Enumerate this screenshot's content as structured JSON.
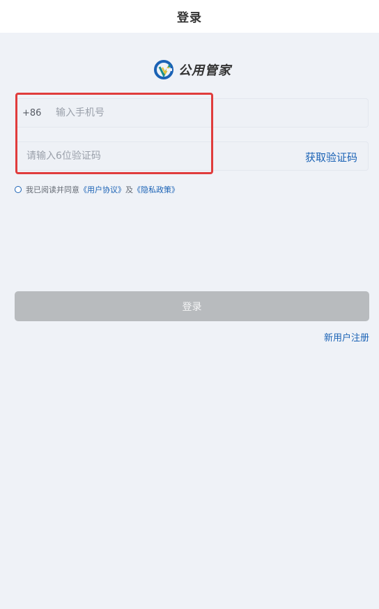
{
  "header": {
    "title": "登录"
  },
  "logo": {
    "text": "公用管家",
    "icon": "company-logo-icon"
  },
  "form": {
    "phone": {
      "prefix": "+86",
      "placeholder": "输入手机号",
      "value": ""
    },
    "code": {
      "placeholder": "请输入6位验证码",
      "value": "",
      "get_code_label": "获取验证码"
    }
  },
  "agreement": {
    "checked": false,
    "prefix_text": "我已阅读并同意",
    "user_agreement": "《用户协议》",
    "and_text": "及",
    "privacy_policy": "《隐私政策》"
  },
  "login_button": {
    "label": "登录",
    "enabled": false
  },
  "register_link": {
    "label": "新用户注册"
  },
  "colors": {
    "accent": "#1a62b5",
    "background": "#eff2f7",
    "disabled_button": "#b8bbbe",
    "highlight": "#e03c3c"
  }
}
